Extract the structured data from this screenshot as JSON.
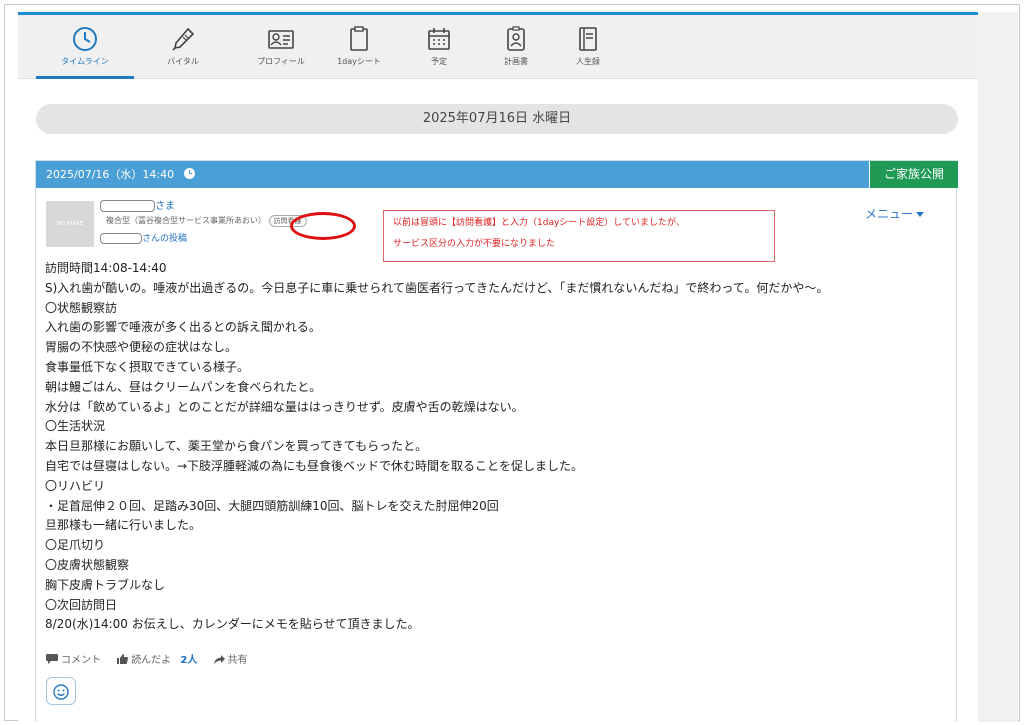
{
  "tabs": [
    {
      "label": "タイムライン",
      "icon": "clock-icon",
      "active": true
    },
    {
      "label": "バイタル",
      "icon": "thermometer-icon",
      "active": false
    },
    {
      "label": "プロフィール",
      "icon": "id-card-icon",
      "active": false
    },
    {
      "label": "1dayシート",
      "icon": "clipboard-icon",
      "active": false
    },
    {
      "label": "予定",
      "icon": "calendar-icon",
      "active": false
    },
    {
      "label": "計画書",
      "icon": "badge-icon",
      "active": false
    },
    {
      "label": "人生録",
      "icon": "book-icon",
      "active": false
    }
  ],
  "date_header": "2025年07月16日 水曜日",
  "post": {
    "timestamp": "2025/07/16（水）14:40",
    "family_label": "ご家族公開",
    "avatar_text": "NO IMAGE",
    "recipient_suffix": "さま",
    "office": "複合型（冨谷複合型サービス事業所あおい）",
    "service_badge": "訪問看護",
    "post_suffix": "さんの投稿",
    "menu_label": "メニュー",
    "notice_lines": [
      "以前は冒頭に【訪問看護】と入力（1dayシート設定）していましたが、",
      "サービス区分の入力が不要になりました"
    ],
    "body_lines": [
      "訪問時間14:08-14:40",
      "S)入れ歯が酷いの。唾液が出過ぎるの。今日息子に車に乗せられて歯医者行ってきたんだけど、「まだ慣れないんだね」で終わって。何だかや〜。",
      "〇状態観察訪",
      "入れ歯の影響で唾液が多く出るとの訴え聞かれる。",
      "胃腸の不快感や便秘の症状はなし。",
      "食事量低下なく摂取できている様子。",
      "朝は鰻ごはん、昼はクリームパンを食べられたと。",
      "水分は「飲めているよ」とのことだが詳細な量ははっきりせず。皮膚や舌の乾燥はない。",
      "〇生活状況",
      "本日旦那様にお願いして、薬王堂から食パンを買ってきてもらったと。",
      "自宅では昼寝はしない。→下肢浮腫軽減の為にも昼食後ベッドで休む時間を取ることを促しました。",
      "〇リハビリ",
      "・足首屈伸２０回、足踏み30回、大腿四頭筋訓練10回、脳トレを交えた肘屈伸20回",
      "旦那様も一緒に行いました。",
      "〇足爪切り",
      "〇皮膚状態観察",
      "胸下皮膚トラブルなし",
      "〇次回訪問日",
      "8/20(水)14:00 お伝えし、カレンダーにメモを貼らせて頂きました。"
    ],
    "actions": {
      "comment": "コメント",
      "like": "読んだよ",
      "like_count": "2人",
      "share": "共有"
    }
  },
  "colors": {
    "accent": "#1f8ad6",
    "card_header": "#4aa0d6",
    "family_button": "#1e9a55",
    "notice_text": "#e02020"
  }
}
